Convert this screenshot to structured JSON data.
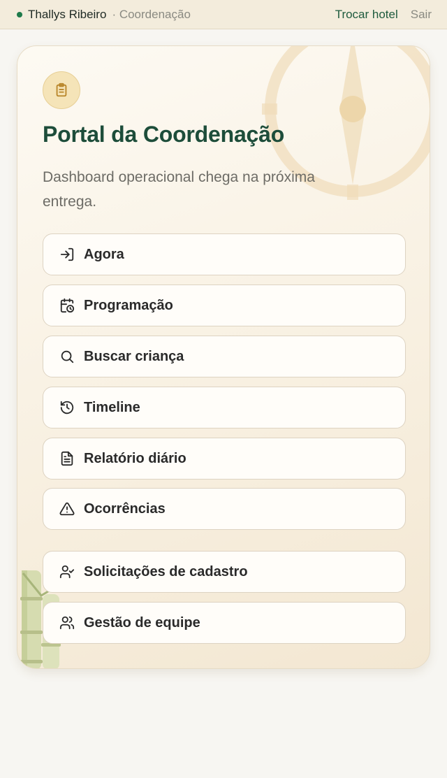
{
  "header": {
    "user_name": "Thallys Ribeiro",
    "role": "· Coordenação",
    "switch_hotel": "Trocar hotel",
    "logout": "Sair",
    "status_color": "#1e7a4a"
  },
  "card": {
    "badge_icon": "clipboard-icon",
    "title": "Portal da Coordenação",
    "subtitle": "Dashboard operacional chega na próxima entrega."
  },
  "menu": [
    {
      "label": "Agora",
      "icon": "login-arrow-icon"
    },
    {
      "label": "Programação",
      "icon": "calendar-clock-icon"
    },
    {
      "label": "Buscar criança",
      "icon": "search-icon"
    },
    {
      "label": "Timeline",
      "icon": "history-icon"
    },
    {
      "label": "Relatório diário",
      "icon": "document-icon"
    },
    {
      "label": "Ocorrências",
      "icon": "warning-icon"
    },
    {
      "label": "Solicitações de cadastro",
      "icon": "user-check-icon"
    },
    {
      "label": "Gestão de equipe",
      "icon": "users-icon"
    }
  ],
  "colors": {
    "accent": "#1d4d3a",
    "background": "#f7f6f2",
    "card_bg": "#fbf5ea",
    "badge_bg": "#f5e4b8"
  }
}
